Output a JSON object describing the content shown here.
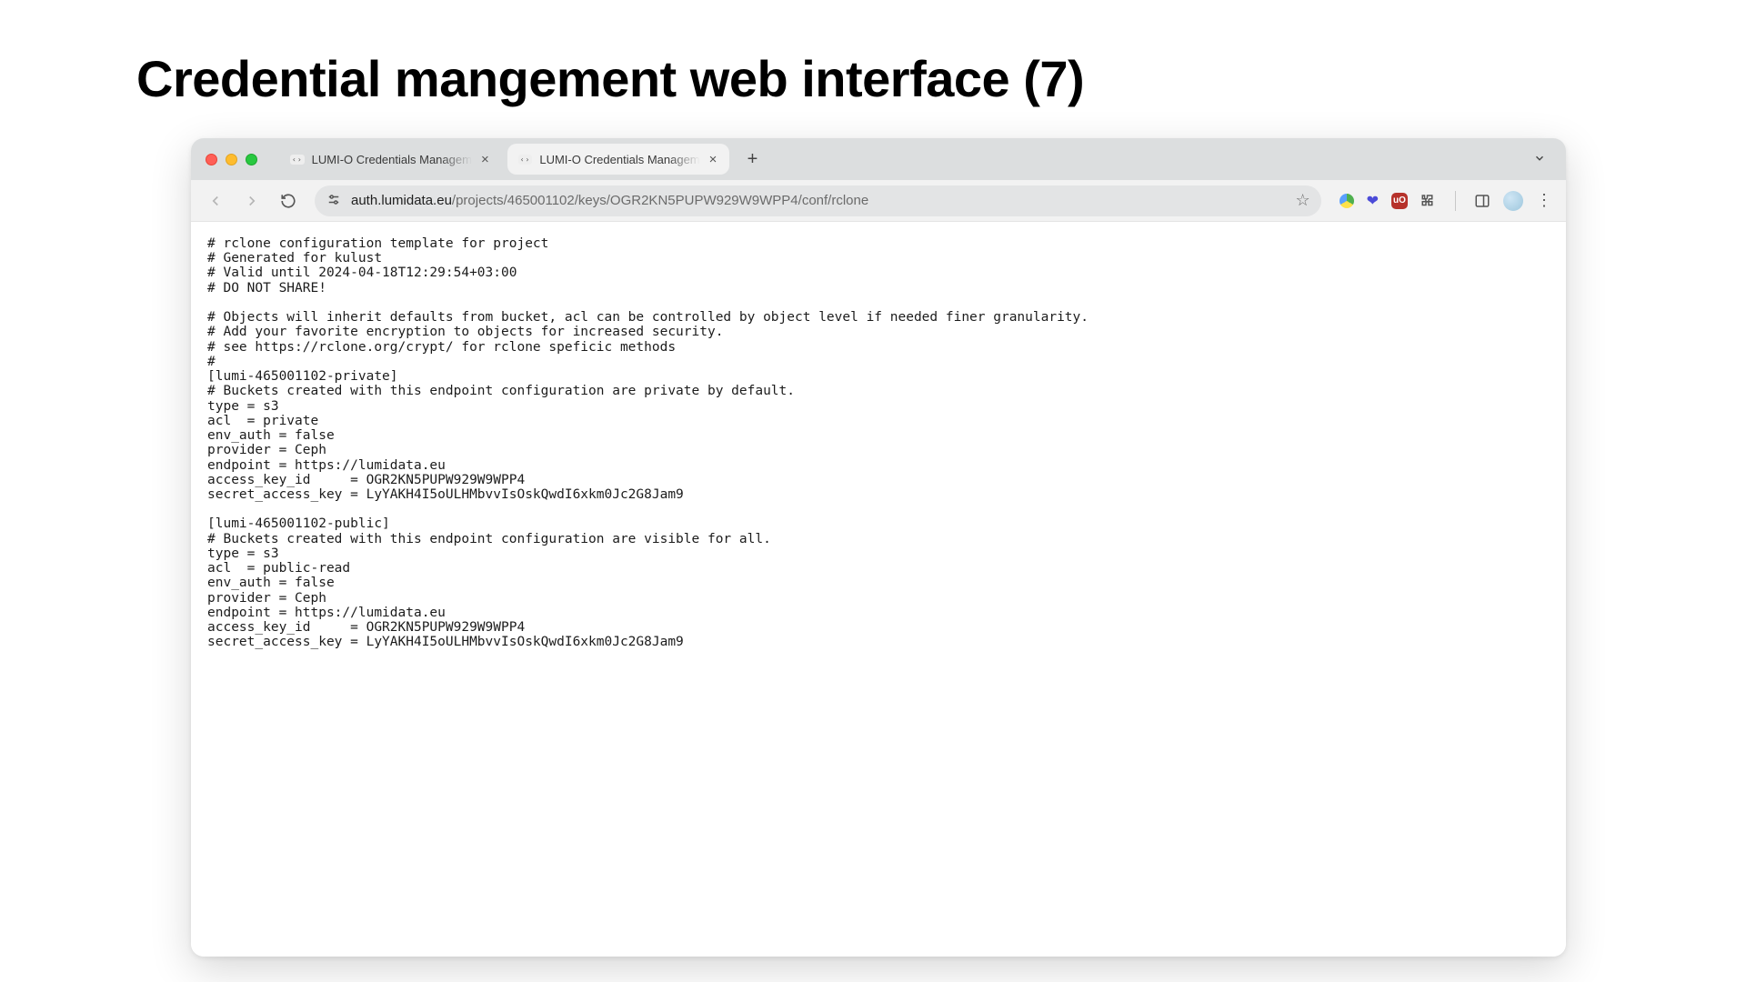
{
  "slide": {
    "title": "Credential mangement web interface (7)"
  },
  "browser": {
    "tabs": [
      {
        "favicon": "‹›",
        "title": "LUMI-O Credentials Managem",
        "active": false
      },
      {
        "favicon": "‹›",
        "title": "LUMI-O Credentials Managem",
        "active": true
      }
    ],
    "url_host": "auth.lumidata.eu",
    "url_path": "/projects/465001102/keys/OGR2KN5PUPW929W9WPP4/conf/rclone",
    "extensions": {
      "ublock_label": "uO"
    }
  },
  "config_text": "# rclone configuration template for project\n# Generated for kulust\n# Valid until 2024-04-18T12:29:54+03:00\n# DO NOT SHARE!\n\n# Objects will inherit defaults from bucket, acl can be controlled by object level if needed finer granularity.\n# Add your favorite encryption to objects for increased security.\n# see https://rclone.org/crypt/ for rclone speficic methods\n#\n[lumi-465001102-private]\n# Buckets created with this endpoint configuration are private by default.\ntype = s3\nacl  = private\nenv_auth = false\nprovider = Ceph\nendpoint = https://lumidata.eu\naccess_key_id     = OGR2KN5PUPW929W9WPP4\nsecret_access_key = LyYAKH4I5oULHMbvvIsOskQwdI6xkm0Jc2G8Jam9\n\n[lumi-465001102-public]\n# Buckets created with this endpoint configuration are visible for all.\ntype = s3\nacl  = public-read\nenv_auth = false\nprovider = Ceph\nendpoint = https://lumidata.eu\naccess_key_id     = OGR2KN5PUPW929W9WPP4\nsecret_access_key = LyYAKH4I5oULHMbvvIsOskQwdI6xkm0Jc2G8Jam9"
}
